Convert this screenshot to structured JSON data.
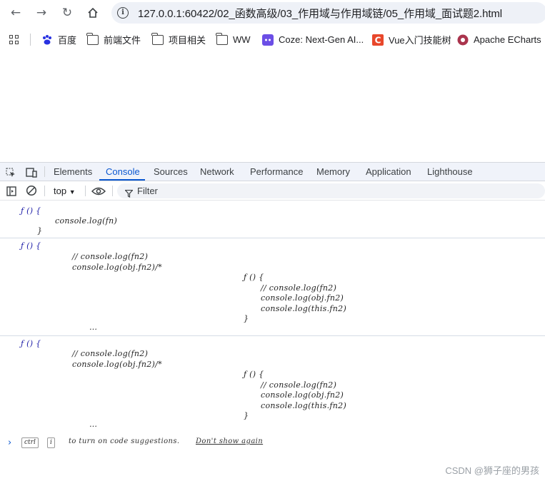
{
  "browser": {
    "url": "127.0.0.1:60422/02_函数高级/03_作用域与作用域链/05_作用域_面试题2.html",
    "bookmarks": [
      {
        "label": "百度",
        "icon": "baidu-icon"
      },
      {
        "label": "前端文件",
        "icon": "folder-icon"
      },
      {
        "label": "项目相关",
        "icon": "folder-icon"
      },
      {
        "label": "WW",
        "icon": "folder-icon"
      },
      {
        "label": "Coze: Next-Gen AI...",
        "icon": "coze-icon"
      },
      {
        "label": "Vue入门技能树",
        "icon": "csdn-icon"
      },
      {
        "label": "Apache ECharts",
        "icon": "echarts-icon"
      }
    ]
  },
  "devtools": {
    "tabs": [
      "Elements",
      "Console",
      "Sources",
      "Network",
      "Performance",
      "Memory",
      "Application",
      "Lighthouse"
    ],
    "active_tab": "Console",
    "context": "top",
    "filter_placeholder": "Filter",
    "messages": [
      {
        "lines": [
          "ƒ () {",
          "console.log(fn)",
          "}"
        ]
      },
      {
        "lines": [
          "ƒ () {",
          "// console.log(fn2)",
          "console.log(obj.fn2)/*",
          "ƒ () {",
          "// console.log(fn2)",
          "console.log(obj.fn2)",
          "console.log(this.fn2)",
          "}",
          "…"
        ]
      },
      {
        "lines": [
          "ƒ () {",
          "// console.log(fn2)",
          "console.log(obj.fn2)/*",
          "ƒ () {",
          "// console.log(fn2)",
          "console.log(obj.fn2)",
          "console.log(this.fn2)",
          "}",
          "…"
        ]
      }
    ],
    "suggestion": {
      "key1": "ctrl",
      "key2": "i",
      "text": "to turn on code suggestions.",
      "dismiss": "Don't show again"
    }
  },
  "watermark": "CSDN @狮子座的男孩",
  "colors": {
    "accent": "#0b57d0",
    "toolbar_bg": "#f0f3fa"
  }
}
